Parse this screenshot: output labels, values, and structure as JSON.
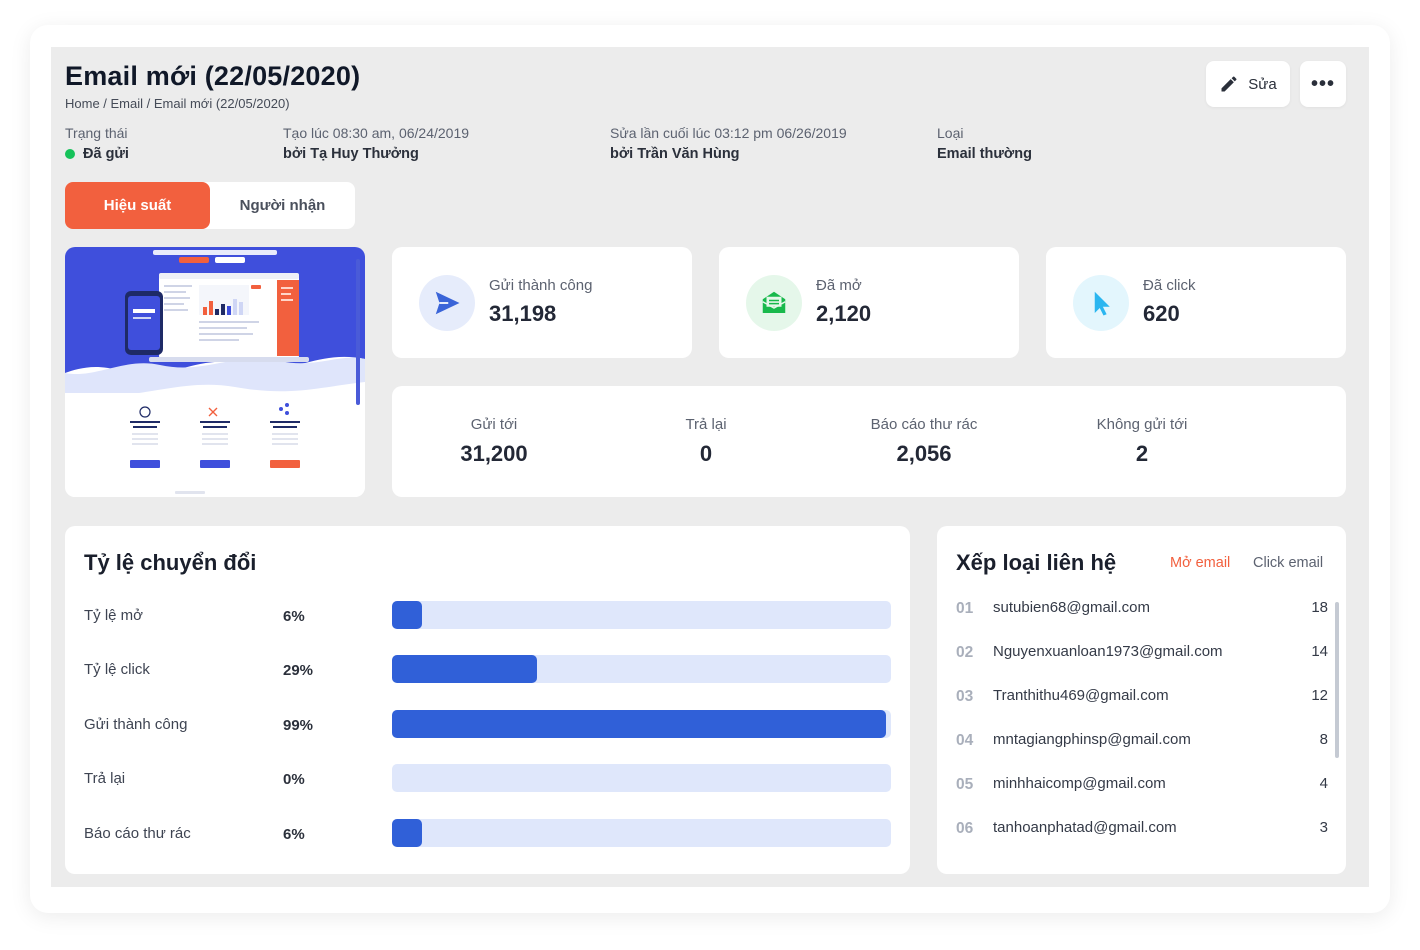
{
  "page": {
    "title": "Email mới (22/05/2020)",
    "breadcrumb": "Home / Email / Email mới (22/05/2020)"
  },
  "actions": {
    "edit_label": "Sửa",
    "more_label": "•••"
  },
  "meta": {
    "status_label": "Trạng thái",
    "status_value": "Đã gửi",
    "created_label": "Tạo lúc 08:30 am, 06/24/2019",
    "created_by": "bởi Tạ Huy Thưởng",
    "edited_label": "Sửa lần cuối lúc 03:12 pm 06/26/2019",
    "edited_by": "bởi Trần Văn Hùng",
    "type_label": "Loại",
    "type_value": "Email thường",
    "status_color": "#16c25a"
  },
  "tabs": [
    {
      "label": "Hiệu suất",
      "active": true
    },
    {
      "label": "Người nhận",
      "active": false
    }
  ],
  "stats": [
    {
      "label": "Gửi thành công",
      "value": "31,198",
      "icon": "send-icon",
      "color": "#3a64d8"
    },
    {
      "label": "Đã mở",
      "value": "2,120",
      "icon": "open-mail-icon",
      "color": "#18b94c"
    },
    {
      "label": "Đã click",
      "value": "620",
      "icon": "cursor-icon",
      "color": "#2bb6f0"
    }
  ],
  "delivery": [
    {
      "label": "Gửi tới",
      "value": "31,200"
    },
    {
      "label": "Trả lại",
      "value": "0"
    },
    {
      "label": "Báo cáo thư rác",
      "value": "2,056"
    },
    {
      "label": "Không gửi tới",
      "value": "2"
    }
  ],
  "conversion": {
    "title": "Tỷ lệ chuyển đổi",
    "rows": [
      {
        "label": "Tỷ lệ mở",
        "pct_text": "6%",
        "pct": 6
      },
      {
        "label": "Tỷ lệ click",
        "pct_text": "29%",
        "pct": 29
      },
      {
        "label": "Gửi thành công",
        "pct_text": "99%",
        "pct": 99
      },
      {
        "label": "Trả lại",
        "pct_text": "0%",
        "pct": 0
      },
      {
        "label": "Báo cáo thư rác",
        "pct_text": "6%",
        "pct": 6
      }
    ],
    "bar_color": "#3060d8",
    "track_color": "#dfe7fb"
  },
  "ranking": {
    "title": "Xếp loại liên hệ",
    "tab_open": "Mở email",
    "tab_click": "Click email",
    "items": [
      {
        "num": "01",
        "email": "sutubien68@gmail.com",
        "count": "18"
      },
      {
        "num": "02",
        "email": "Nguyenxuanloan1973@gmail.com",
        "count": "14"
      },
      {
        "num": "03",
        "email": "Tranthithu469@gmail.com",
        "count": "12"
      },
      {
        "num": "04",
        "email": "mntagiangphinsp@gmail.com",
        "count": "8"
      },
      {
        "num": "05",
        "email": "minhhaicomp@gmail.com",
        "count": "4"
      },
      {
        "num": "06",
        "email": "tanhoanphatad@gmail.com",
        "count": "3"
      }
    ]
  },
  "accent": "#f2603e"
}
